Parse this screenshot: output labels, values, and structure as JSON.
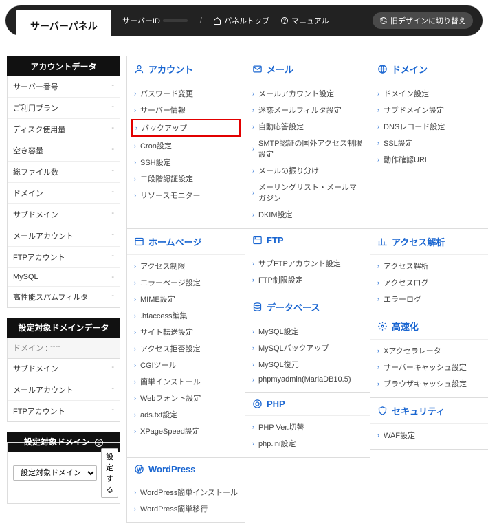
{
  "top": {
    "title": "サーバーパネル",
    "server_id_label": "サーバーID",
    "server_id_value": " ",
    "panel_top": "パネルトップ",
    "manual": "マニュアル",
    "switch_design": "旧デザインに切り替え"
  },
  "sidebar": {
    "account_header": "アカウントデータ",
    "account_items": [
      "サーバー番号",
      "ご利用プラン",
      "ディスク使用量",
      "空き容量",
      "総ファイル数",
      "ドメイン",
      "サブドメイン",
      "メールアカウント",
      "FTPアカウント",
      "MySQL",
      "高性能スパムフィルタ"
    ],
    "domain_header": "設定対象ドメインデータ",
    "domain_items_label": "ドメイン :",
    "domain_items_value": "----",
    "domain_sub": [
      "サブドメイン",
      "メールアカウント",
      "FTPアカウント"
    ],
    "target_header": "設定対象ドメイン",
    "select_label": "設定対象ドメイン",
    "select_button": "設定する"
  },
  "cards": {
    "account": {
      "title": "アカウント",
      "items": [
        "パスワード変更",
        "サーバー情報",
        "バックアップ",
        "Cron設定",
        "SSH設定",
        "二段階認証設定",
        "リソースモニター"
      ],
      "highlight": 2
    },
    "mail": {
      "title": "メール",
      "items": [
        "メールアカウント設定",
        "迷惑メールフィルタ設定",
        "自動応答設定",
        "SMTP認証の国外アクセス制限設定",
        "メールの振り分け",
        "メーリングリスト・メールマガジン",
        "DKIM設定"
      ]
    },
    "domain": {
      "title": "ドメイン",
      "items": [
        "ドメイン設定",
        "サブドメイン設定",
        "DNSレコード設定",
        "SSL設定",
        "動作確認URL"
      ]
    },
    "homepage": {
      "title": "ホームページ",
      "items": [
        "アクセス制限",
        "エラーページ設定",
        "MIME設定",
        ".htaccess編集",
        "サイト転送設定",
        "アクセス拒否設定",
        "CGIツール",
        "簡単インストール",
        "Webフォント設定",
        "ads.txt設定",
        "XPageSpeed設定"
      ]
    },
    "ftp": {
      "title": "FTP",
      "items": [
        "サブFTPアカウント設定",
        "FTP制限設定"
      ]
    },
    "access": {
      "title": "アクセス解析",
      "items": [
        "アクセス解析",
        "アクセスログ",
        "エラーログ"
      ]
    },
    "database": {
      "title": "データベース",
      "items": [
        "MySQL設定",
        "MySQLバックアップ",
        "MySQL復元",
        "phpmyadmin(MariaDB10.5)"
      ]
    },
    "speed": {
      "title": "高速化",
      "items": [
        "Xアクセラレータ",
        "サーバーキャッシュ設定",
        "ブラウザキャッシュ設定"
      ]
    },
    "php": {
      "title": "PHP",
      "items": [
        "PHP Ver.切替",
        "php.ini設定"
      ]
    },
    "security": {
      "title": "セキュリティ",
      "items": [
        "WAF設定"
      ]
    },
    "wordpress": {
      "title": "WordPress",
      "items": [
        "WordPress簡単インストール",
        "WordPress簡単移行"
      ]
    }
  }
}
